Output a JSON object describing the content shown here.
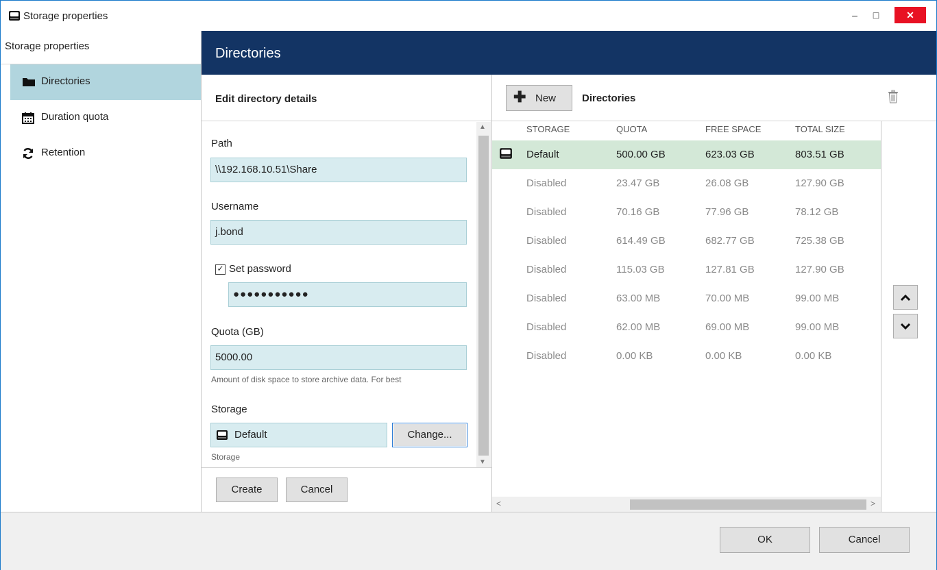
{
  "window": {
    "title": "Storage properties",
    "min_label": "–",
    "max_label": "□",
    "close_label": "✕"
  },
  "sidebar": {
    "title": "Storage properties",
    "items": [
      {
        "label": "Directories",
        "icon": "folder-icon",
        "selected": true
      },
      {
        "label": "Duration quota",
        "icon": "calendar-icon",
        "selected": false
      },
      {
        "label": "Retention",
        "icon": "refresh-icon",
        "selected": false
      }
    ]
  },
  "header": {
    "title": "Directories"
  },
  "edit": {
    "title": "Edit directory details",
    "path": {
      "label": "Path",
      "value": "\\\\192.168.10.51\\Share"
    },
    "username": {
      "label": "Username",
      "value": "j.bond"
    },
    "set_password": {
      "label": "Set password",
      "checked": true,
      "value": "●●●●●●●●●●●"
    },
    "quota": {
      "label": "Quota (GB)",
      "value": "5000.00",
      "hint": "Amount of disk space to store archive data. For best"
    },
    "storage": {
      "label": "Storage",
      "value": "Default",
      "change_label": "Change...",
      "hint": "Storage"
    },
    "create_label": "Create",
    "cancel_label": "Cancel"
  },
  "directories": {
    "new_label": "New",
    "title": "Directories",
    "columns": [
      "STORAGE",
      "QUOTA",
      "FREE SPACE",
      "TOTAL SIZE"
    ],
    "rows": [
      {
        "storage": "Default",
        "quota": "500.00 GB",
        "free": "623.03 GB",
        "total": "803.51 GB",
        "selected": true
      },
      {
        "storage": "Disabled",
        "quota": "23.47 GB",
        "free": "26.08 GB",
        "total": "127.90 GB"
      },
      {
        "storage": "Disabled",
        "quota": "70.16 GB",
        "free": "77.96 GB",
        "total": "78.12 GB"
      },
      {
        "storage": "Disabled",
        "quota": "614.49 GB",
        "free": "682.77 GB",
        "total": "725.38 GB"
      },
      {
        "storage": "Disabled",
        "quota": "115.03 GB",
        "free": "127.81 GB",
        "total": "127.90 GB"
      },
      {
        "storage": "Disabled",
        "quota": "63.00 MB",
        "free": "70.00 MB",
        "total": "99.00 MB"
      },
      {
        "storage": "Disabled",
        "quota": "62.00 MB",
        "free": "69.00 MB",
        "total": "99.00 MB"
      },
      {
        "storage": "Disabled",
        "quota": "0.00 KB",
        "free": "0.00 KB",
        "total": "0.00 KB"
      }
    ]
  },
  "footer": {
    "ok_label": "OK",
    "cancel_label": "Cancel"
  },
  "colors": {
    "header_bg": "#133464",
    "sidebar_selected": "#b1d5de",
    "row_selected": "#d3e8d7",
    "field_bg": "#d8ecf0",
    "close_red": "#e81123"
  }
}
